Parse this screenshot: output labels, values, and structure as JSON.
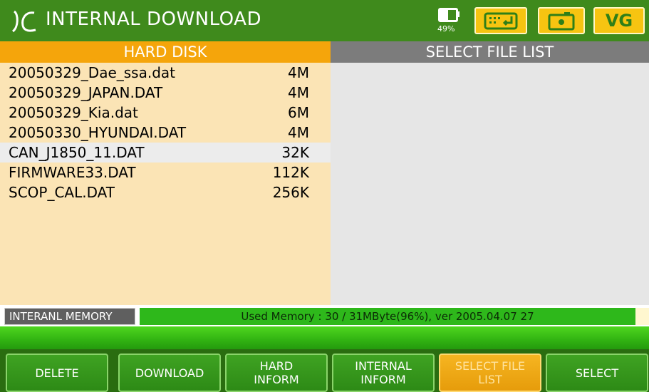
{
  "titlebar": {
    "title": "INTERNAL DOWNLOAD",
    "battery_percent": "49%",
    "battery_icon": "battery-icon",
    "keyboard_icon": "keyboard-icon",
    "camera_icon": "camera-icon",
    "vg_label": "VG"
  },
  "left_panel": {
    "header": "HARD DISK",
    "files": [
      {
        "name": "20050329_Dae_ssa.dat",
        "size": "4M"
      },
      {
        "name": "20050329_JAPAN.DAT",
        "size": "4M"
      },
      {
        "name": "20050329_Kia.dat",
        "size": "6M"
      },
      {
        "name": "20050330_HYUNDAI.DAT",
        "size": "4M"
      },
      {
        "name": "CAN_J1850_11.DAT",
        "size": "32K"
      },
      {
        "name": "FIRMWARE33.DAT",
        "size": "112K"
      },
      {
        "name": "SCOP_CAL.DAT",
        "size": "256K"
      }
    ],
    "selected_index": 4
  },
  "right_panel": {
    "header": "SELECT FILE LIST"
  },
  "status": {
    "memory_label": "INTERANL MEMORY",
    "memory_text": "Used Memory : 30 / 31MByte(96%), ver 2005.04.07 27"
  },
  "buttons": [
    {
      "label": "DELETE"
    },
    {
      "label": "DOWNLOAD"
    },
    {
      "label": "HARD\nINFORM"
    },
    {
      "label": "INTERNAL\nINFORM"
    },
    {
      "label": "SELECT FILE\nLIST"
    },
    {
      "label": "SELECT"
    }
  ],
  "colors": {
    "title_green": "#3f8a1c",
    "accent_orange": "#f5a50b",
    "panel_cream": "#fbe4b5",
    "memory_green": "#2eb81b",
    "button_yellow": "#f7c411"
  }
}
